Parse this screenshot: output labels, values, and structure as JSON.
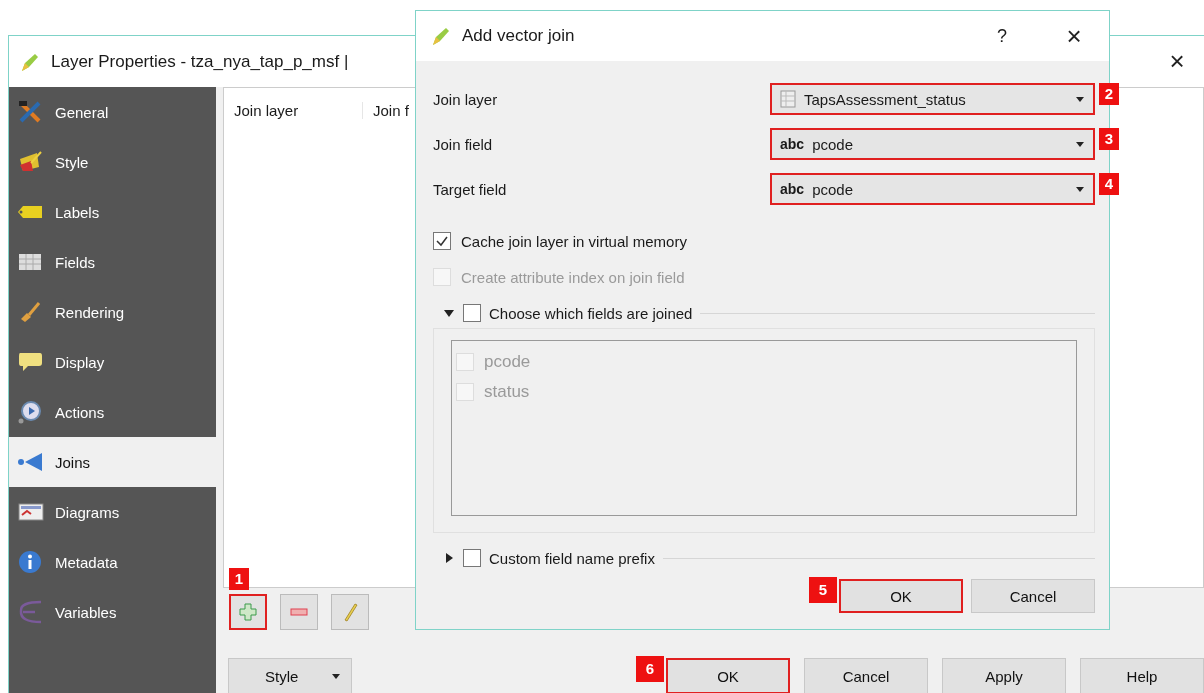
{
  "main_window": {
    "title": "Layer Properties - tza_nya_tap_p_msf |",
    "close_glyph": "×",
    "sidebar": {
      "items": [
        {
          "label": "General",
          "selected": false
        },
        {
          "label": "Style",
          "selected": false
        },
        {
          "label": "Labels",
          "selected": false
        },
        {
          "label": "Fields",
          "selected": false
        },
        {
          "label": "Rendering",
          "selected": false
        },
        {
          "label": "Display",
          "selected": false
        },
        {
          "label": "Actions",
          "selected": false
        },
        {
          "label": "Joins",
          "selected": true
        },
        {
          "label": "Diagrams",
          "selected": false
        },
        {
          "label": "Metadata",
          "selected": false
        },
        {
          "label": "Variables",
          "selected": false
        }
      ]
    },
    "joins_table": {
      "columns": [
        "Join layer",
        "Join f"
      ]
    },
    "toolbar": [
      {
        "kind": "add",
        "callout": "1"
      },
      {
        "kind": "remove"
      },
      {
        "kind": "edit"
      }
    ],
    "style_button": {
      "label": "Style"
    },
    "buttons": [
      {
        "label": "OK",
        "callout": "6"
      },
      {
        "label": "Cancel"
      },
      {
        "label": "Apply"
      },
      {
        "label": "Help"
      }
    ]
  },
  "dialog": {
    "title": "Add vector join",
    "help_glyph": "?",
    "close_glyph": "×",
    "fields": [
      {
        "label": "Join layer",
        "kind": "layer",
        "value": "TapsAssessment_status",
        "callout": "2"
      },
      {
        "label": "Join field",
        "kind": "field",
        "type_tag": "abc",
        "value": "pcode",
        "callout": "3"
      },
      {
        "label": "Target field",
        "kind": "field",
        "type_tag": "abc",
        "value": "pcode",
        "callout": "4"
      }
    ],
    "options": [
      {
        "label": "Cache join layer in virtual memory",
        "checked": true,
        "disabled": false
      },
      {
        "label": "Create attribute index on join field",
        "checked": false,
        "disabled": true
      }
    ],
    "field_group": {
      "label": "Choose which fields are joined",
      "expanded": true,
      "checked": false,
      "fields": [
        {
          "label": "pcode",
          "checked": false,
          "disabled": true
        },
        {
          "label": "status",
          "checked": false,
          "disabled": true
        }
      ]
    },
    "prefix_group": {
      "label": "Custom field name prefix",
      "expanded": false,
      "checked": false
    },
    "buttons": [
      {
        "label": "OK",
        "callout": "5"
      },
      {
        "label": "Cancel"
      }
    ]
  }
}
